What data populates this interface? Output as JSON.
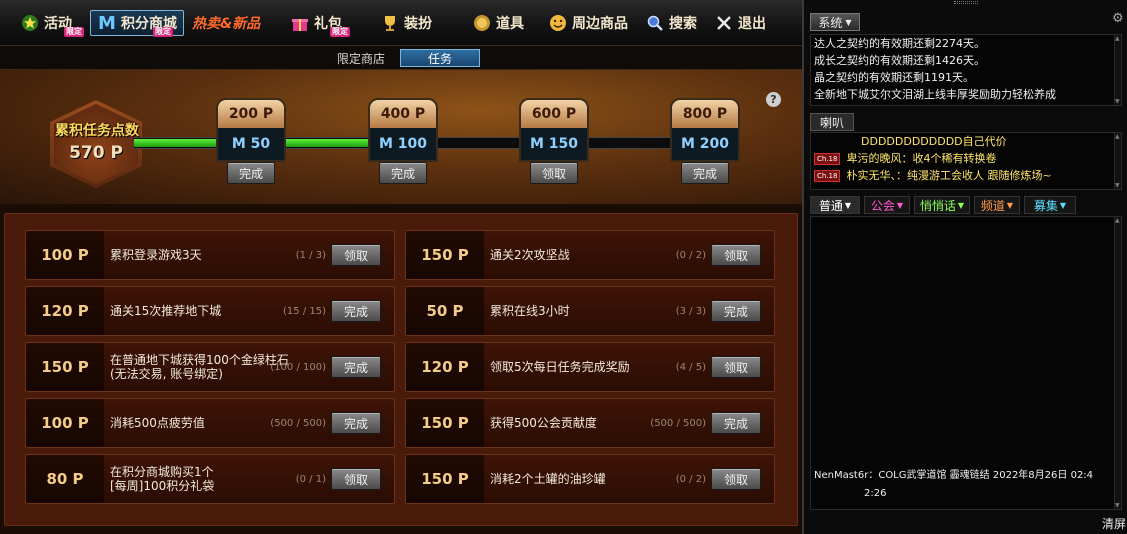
{
  "nav": {
    "items": [
      {
        "label": "活动",
        "tag": "限定",
        "icon": "star-icon"
      },
      {
        "label": "积分商城",
        "tag": "限定",
        "icon": "m-coin-icon"
      },
      {
        "label": "热卖&新品",
        "tag": "",
        "icon": ""
      },
      {
        "label": "礼包",
        "tag": "限定",
        "icon": "gift-icon"
      },
      {
        "label": "装扮",
        "tag": "",
        "icon": "trophy-icon"
      },
      {
        "label": "道具",
        "tag": "",
        "icon": "coin-icon"
      },
      {
        "label": "周边商品",
        "tag": "",
        "icon": "smile-icon"
      },
      {
        "label": "搜索",
        "tag": "",
        "icon": "search-icon"
      },
      {
        "label": "退出",
        "tag": "",
        "icon": "close-icon"
      }
    ]
  },
  "subtabs": [
    "限定商店",
    "任务"
  ],
  "summary": {
    "title": "累积任务点数",
    "points": "570 P",
    "current": 570
  },
  "milestones": [
    {
      "points": "200 P",
      "reward": "M 50",
      "button": "完成"
    },
    {
      "points": "400 P",
      "reward": "M 100",
      "button": "完成"
    },
    {
      "points": "600 P",
      "reward": "M 150",
      "button": "领取"
    },
    {
      "points": "800 P",
      "reward": "M 200",
      "button": "完成"
    }
  ],
  "help": "?",
  "tasks": [
    {
      "points": "100 P",
      "desc": "累积登录游戏3天",
      "progress": "(1 / 3)",
      "button": "领取"
    },
    {
      "points": "150 P",
      "desc": "通关2次攻坚战",
      "progress": "(0 / 2)",
      "button": "领取"
    },
    {
      "points": "120 P",
      "desc": "通关15次推荐地下城",
      "progress": "(15 / 15)",
      "button": "完成"
    },
    {
      "points": "50 P",
      "desc": "累积在线3小时",
      "progress": "(3 / 3)",
      "button": "完成"
    },
    {
      "points": "150 P",
      "desc": "在普通地下城获得100个金绿柱石\n(无法交易, 账号绑定)",
      "progress": "(100 / 100)",
      "button": "完成"
    },
    {
      "points": "120 P",
      "desc": "领取5次每日任务完成奖励",
      "progress": "(4 / 5)",
      "button": "领取"
    },
    {
      "points": "100 P",
      "desc": "消耗500点疲劳值",
      "progress": "(500 / 500)",
      "button": "完成"
    },
    {
      "points": "150 P",
      "desc": "获得500公会贡献度",
      "progress": "(500 / 500)",
      "button": "完成"
    },
    {
      "points": "80 P",
      "desc": "在积分商城购买1个\n[每周]100积分礼袋",
      "progress": "(0 / 1)",
      "button": "领取"
    },
    {
      "points": "150 P",
      "desc": "消耗2个土罐的油珍罐",
      "progress": "(0 / 2)",
      "button": "领取"
    }
  ],
  "chat": {
    "system_label": "系统",
    "system_lines": [
      "达人之契约的有效期还剩2274天。",
      "成长之契约的有效期还剩1426天。",
      "晶之契约的有效期还剩1191天。",
      "全新地下城艾尔文泪湖上线丰厚奖励助力轻松养成"
    ],
    "horn_label": "喇叭",
    "horn_lines": [
      {
        "badge": "",
        "text": "DDDDDDDDDDDD自己代价"
      },
      {
        "badge": "Ch.18",
        "text": "卑污的晚风：收4个稀有转换卷"
      },
      {
        "badge": "Ch.18",
        "text": "朴实无华、：纯漫游工会收人 跟随修炼场~"
      }
    ],
    "tabs": [
      {
        "label": "普通",
        "color": "#ffffff"
      },
      {
        "label": "公会",
        "color": "#ff5ad0"
      },
      {
        "label": "悄悄话",
        "color": "#8cff5a"
      },
      {
        "label": "频道",
        "color": "#ff9a4a"
      },
      {
        "label": "募集",
        "color": "#5ae0ff"
      }
    ],
    "message_line1": "NenMast6r：COLG武掌道馆 霾魂链结  2022年8月26日 02:4",
    "message_line2": "2:26",
    "clear_label": "清屏"
  }
}
